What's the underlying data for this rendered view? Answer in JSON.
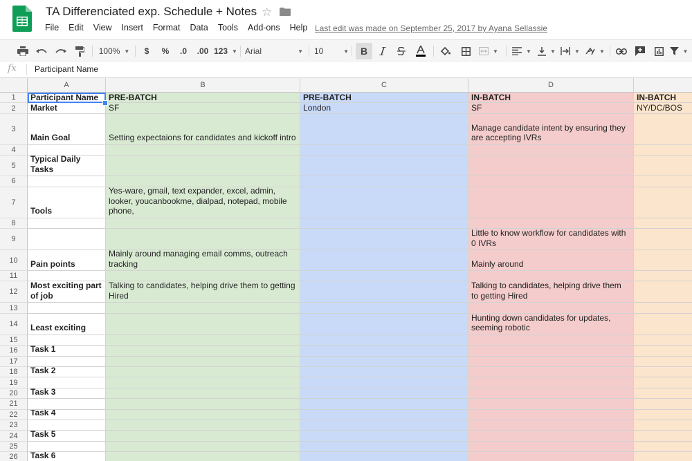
{
  "doc": {
    "title": "TA Differenciated exp. Schedule + Notes",
    "last_edit": "Last edit was made on September 25, 2017 by Ayana Sellassie"
  },
  "menu": [
    "File",
    "Edit",
    "View",
    "Insert",
    "Format",
    "Data",
    "Tools",
    "Add-ons",
    "Help"
  ],
  "toolbar": {
    "zoom": "100%",
    "currency": "$",
    "percent": "%",
    "dec_less": ".0",
    "dec_more": ".00",
    "more_formats": "123",
    "font": "Arial",
    "size": "10",
    "bold": "B"
  },
  "formula": {
    "fx": "fx",
    "value": "Participant Name"
  },
  "colors": {
    "green": "#d9ead3",
    "blue": "#c9daf8",
    "red": "#f4cccc",
    "orange": "#fce5cd",
    "selection": "#4285f4"
  },
  "columns": [
    "A",
    "B",
    "C",
    "D"
  ],
  "rows": [
    {
      "n": "1",
      "a": "Participant Name",
      "b": "PRE-BATCH",
      "c": "PRE-BATCH",
      "d": "IN-BATCH",
      "e": "IN-BATCH"
    },
    {
      "n": "2",
      "a": "Market",
      "b": "SF",
      "c": "London",
      "d": "SF",
      "e": "NY/DC/BOS"
    },
    {
      "n": "3",
      "a": "Main Goal",
      "b": "Setting expectaions for candidates and kickoff intro",
      "c": "",
      "d": "Manage candidate intent by ensuring they are accepting IVRs",
      "e": ""
    },
    {
      "n": "4",
      "a": "",
      "b": "",
      "c": "",
      "d": "",
      "e": ""
    },
    {
      "n": "5",
      "a": "Typical Daily Tasks",
      "b": "",
      "c": "",
      "d": "",
      "e": ""
    },
    {
      "n": "6",
      "a": "",
      "b": "",
      "c": "",
      "d": "",
      "e": ""
    },
    {
      "n": "7",
      "a": "Tools",
      "b": "Yes-ware, gmail, text expander, excel, admin, looker, youcanbookme, dialpad, notepad, mobile phone,",
      "c": "",
      "d": "",
      "e": ""
    },
    {
      "n": "8",
      "a": "",
      "b": "",
      "c": "",
      "d": "",
      "e": ""
    },
    {
      "n": "9",
      "a": "",
      "b": "",
      "c": "",
      "d": "Little to know workflow for candidates with 0 IVRs",
      "e": ""
    },
    {
      "n": "10",
      "a": "Pain points",
      "b": "Mainly around managing email comms, outreach tracking",
      "c": "",
      "d": "Mainly around",
      "e": ""
    },
    {
      "n": "11",
      "a": "",
      "b": "",
      "c": "",
      "d": "",
      "e": ""
    },
    {
      "n": "12",
      "a": "Most exciting part of job",
      "b": "Talking to candidates, helping drive them to getting Hired",
      "c": "",
      "d": "Talking to candidates, helping drive them to getting Hired",
      "e": ""
    },
    {
      "n": "13",
      "a": "",
      "b": "",
      "c": "",
      "d": "",
      "e": ""
    },
    {
      "n": "14",
      "a": "Least exciting",
      "b": "",
      "c": "",
      "d": "Hunting down candidates for updates, seeming robotic",
      "e": ""
    },
    {
      "n": "15",
      "a": "",
      "b": "",
      "c": "",
      "d": "",
      "e": ""
    },
    {
      "n": "16",
      "a": "Task 1",
      "b": "",
      "c": "",
      "d": "",
      "e": ""
    },
    {
      "n": "17",
      "a": "",
      "b": "",
      "c": "",
      "d": "",
      "e": ""
    },
    {
      "n": "18",
      "a": "Task 2",
      "b": "",
      "c": "",
      "d": "",
      "e": ""
    },
    {
      "n": "19",
      "a": "",
      "b": "",
      "c": "",
      "d": "",
      "e": ""
    },
    {
      "n": "20",
      "a": "Task 3",
      "b": "",
      "c": "",
      "d": "",
      "e": ""
    },
    {
      "n": "21",
      "a": "",
      "b": "",
      "c": "",
      "d": "",
      "e": ""
    },
    {
      "n": "22",
      "a": "Task 4",
      "b": "",
      "c": "",
      "d": "",
      "e": ""
    },
    {
      "n": "23",
      "a": "",
      "b": "",
      "c": "",
      "d": "",
      "e": ""
    },
    {
      "n": "24",
      "a": "Task 5",
      "b": "",
      "c": "",
      "d": "",
      "e": ""
    },
    {
      "n": "25",
      "a": "",
      "b": "",
      "c": "",
      "d": "",
      "e": ""
    },
    {
      "n": "26",
      "a": "Task 6",
      "b": "",
      "c": "",
      "d": "",
      "e": ""
    }
  ]
}
